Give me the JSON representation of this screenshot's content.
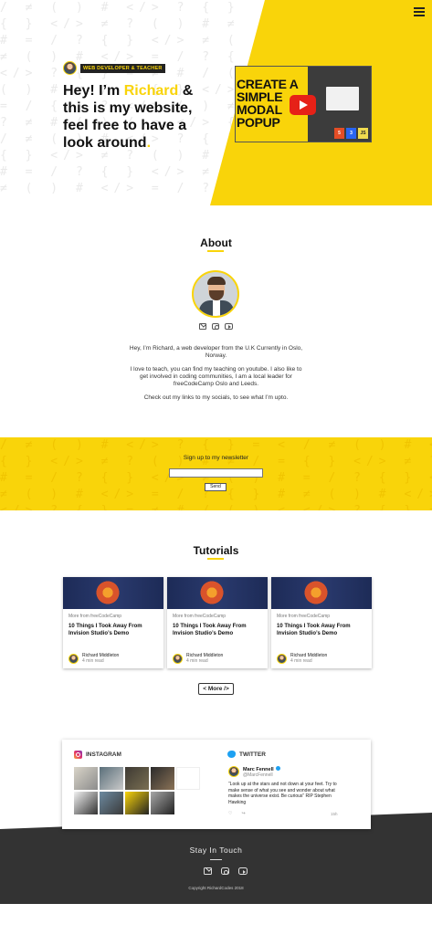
{
  "colors": {
    "accent": "#f9d40a",
    "dark": "#333333"
  },
  "hero": {
    "menu_icon": "hamburger-icon",
    "role": "WEB DEVELOPER & TEACHER",
    "greeting": "Hey! I’m",
    "name": "Richard",
    "line_rest": "& this is my website, feel free to have a look around",
    "period": ".",
    "video": {
      "text": "CREATE A SIMPLE MODAL POPUP",
      "play_icon": "play-icon"
    }
  },
  "about": {
    "title": "About",
    "icons": [
      "mail-icon",
      "instagram-icon",
      "youtube-icon"
    ],
    "p1": "Hey, I’m Richard, a web developer from the U.K Currently in Oslo, Norway.",
    "p2": "I love to teach, you can find my teaching on youtube. I also like to get involved in coding communities, I am a local leader for freeCodeCamp Oslo and Leeds.",
    "p3": "Check out my links to my socials, to see what I’m upto."
  },
  "newsletter": {
    "label": "Sign up to my newsletter",
    "input_value": "",
    "button": "Send"
  },
  "tutorials": {
    "title": "Tutorials",
    "cards": [
      {
        "source": "More from freeCodeCamp",
        "title": "10 Things I Took Away From Invision Studio’s Demo",
        "author": "Richard Middleton",
        "read": "4 min read"
      },
      {
        "source": "More from freeCodeCamp",
        "title": "10 Things I Took Away From Invision Studio’s Demo",
        "author": "Richard Middleton",
        "read": "4 min read"
      },
      {
        "source": "More from freeCodeCamp",
        "title": "10 Things I Took Away From Invision Studio’s Demo",
        "author": "Richard Middleton",
        "read": "4 min read"
      }
    ],
    "more_button": "< More />"
  },
  "social": {
    "instagram_label": "INSTAGRAM",
    "twitter_label": "TWITTER",
    "tweet": {
      "name": "Marc Fennell",
      "handle": "@MarcFennell",
      "text": "“Look up at the stars and not down at your feet. Try to make sense of what you see and wonder about what makes the universe exist. Be curious” RIP Stephen Hawking",
      "time": "15h"
    }
  },
  "footer": {
    "title": "Stay In Touch",
    "copyright": "Copyright RichardCodes 2018"
  }
}
